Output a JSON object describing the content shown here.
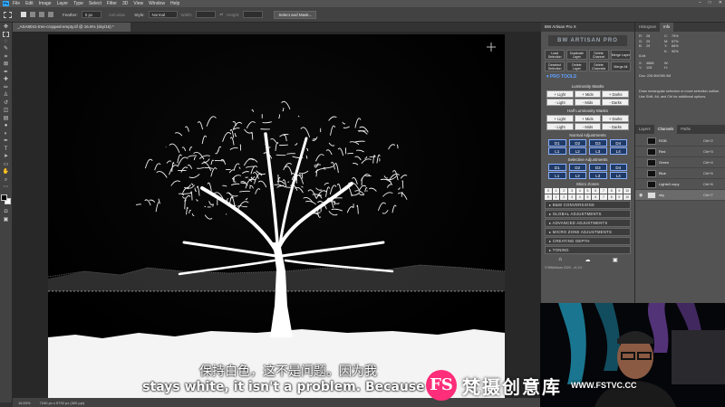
{
  "menubar": {
    "logo": "Ps",
    "items": [
      "File",
      "Edit",
      "Image",
      "Layer",
      "Type",
      "Select",
      "Filter",
      "3D",
      "View",
      "Window",
      "Help"
    ],
    "window_controls": [
      "–",
      "□",
      "✕"
    ]
  },
  "options": {
    "feather_label": "Feather:",
    "feather_value": "0 px",
    "antialias": "Anti-alias",
    "style_label": "Style:",
    "style_value": "Normal",
    "width_label": "Width:",
    "height_label": "Height:",
    "select_mask": "Select and Mask..."
  },
  "document": {
    "tab_title": "_ASA8041-tree-cropped-empty.tif @ 16.6% (sky/16) *",
    "zoom": "16.63%",
    "dims": "7240 px x 5792 px (300 ppi)"
  },
  "bw_panel": {
    "header": "BW Artisan Pro X",
    "logo": "BW ARTISAN PRO",
    "top_buttons": [
      "Load Selection",
      "Duplicate Layer",
      "Delete Channel",
      "Merge Layer",
      "Deselect Selection",
      "Delete Layer",
      "Delete Channels",
      "Merge All"
    ],
    "pro_tools": "PRO TOOLS",
    "luminosity_title": "Luminosity Masks",
    "luminosity_row1": [
      "+ Light",
      "+ Mids",
      "+ Darks"
    ],
    "luminosity_row2": [
      "- Light",
      "- Mids",
      "- Darks"
    ],
    "half_title": "Half Luminosity Masks",
    "half_row1": [
      "+ Light",
      "+ Mids",
      "+ Darks"
    ],
    "half_row2": [
      "- Light",
      "- Mids",
      "- Darks"
    ],
    "normal_title": "Normal Adjustments",
    "normal_row1": [
      "D1",
      "D2",
      "D3",
      "D4"
    ],
    "normal_row2": [
      "L1",
      "L2",
      "L3",
      "L4"
    ],
    "selective_title": "Selective Adjustments",
    "selective_row1": [
      "D1",
      "D2",
      "D3",
      "D4"
    ],
    "selective_row2": [
      "L1",
      "L2",
      "L3",
      "L4"
    ],
    "micro_title": "Micro Zones",
    "micro_row1": [
      "0",
      "1",
      "2",
      "3",
      "4",
      "5",
      "6",
      "7",
      "8",
      "9",
      "10"
    ],
    "micro_row2": [
      "0",
      "1",
      "2",
      "3",
      "4",
      "5",
      "6",
      "7",
      "8",
      "9",
      "10"
    ],
    "sections": [
      "B&W CONVERSIONS",
      "GLOBAL ADJUSTMENTS",
      "ADVANCED ADJUSTMENTS",
      "MICRO ZONE ADJUSTMENTS",
      "CREATING DEPTH",
      "TONING"
    ],
    "footer": "© BWArtisan 2020 - v1.3.0"
  },
  "right_panel": {
    "tabs_top": [
      "Histogram",
      "Info"
    ],
    "info": {
      "r": "R:",
      "r_val": "28",
      "g": "G:",
      "g_val": "29",
      "b": "B:",
      "b_val": "29",
      "c": "C:",
      "c_val": "75%",
      "m": "M:",
      "m_val": "67%",
      "y": "Y:",
      "y_val": "66%",
      "k": "K:",
      "k_val": "90%",
      "bits": "8-bit",
      "x": "X:",
      "x_val": "4888",
      "yy": "Y:",
      "yy_val": "128",
      "w": "W:",
      "h": "H:",
      "doc": "Doc: 226.9M/390.9M",
      "hint": "Draw rectangular selection or move selection outline. Use Shift, Alt, and Ctrl for additional options."
    },
    "tabs_bottom": [
      "Layers",
      "Channels",
      "Paths"
    ],
    "channels": [
      {
        "name": "RGB",
        "key": "Ctrl+2"
      },
      {
        "name": "Red",
        "key": "Ctrl+3"
      },
      {
        "name": "Green",
        "key": "Ctrl+4"
      },
      {
        "name": "Blue",
        "key": "Ctrl+5"
      },
      {
        "name": "Lights3 copy",
        "key": "Ctrl+6"
      },
      {
        "name": "sky",
        "key": "Ctrl+7"
      }
    ]
  },
  "subtitles": {
    "cn": "保持白色，这不是问题。因为我",
    "en": "stays white, it isn't a problem. Because I"
  },
  "watermark": {
    "logo": "FS",
    "cn": "梵摄创意库",
    "url": "WWW.FSTVC.CC"
  },
  "colors": {
    "accent": "#31a8ff",
    "pro_tools": "#5fa0ff",
    "watermark_pink": "#ff2e7a"
  }
}
